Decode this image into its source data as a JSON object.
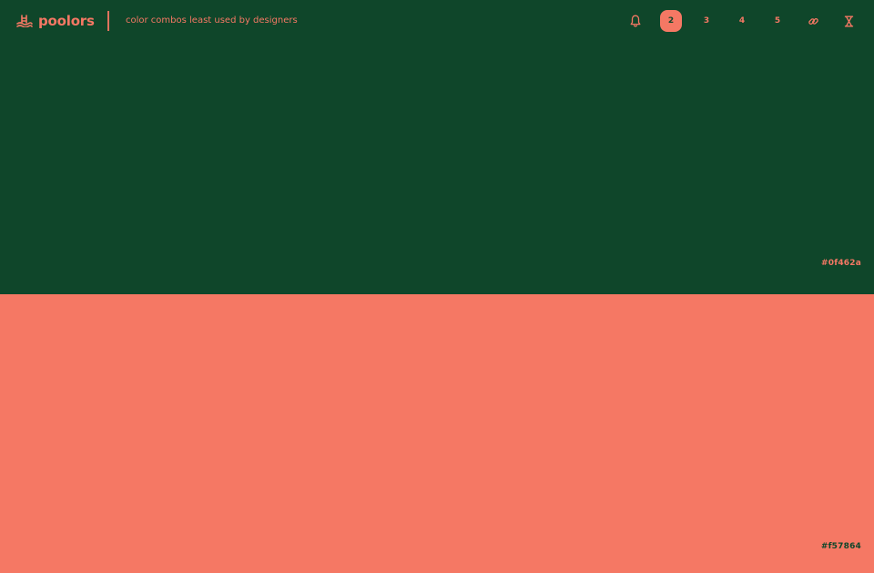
{
  "colors": {
    "primary": "#0f462a",
    "secondary": "#f57864"
  },
  "header": {
    "brand_name": "poolors",
    "brand_icon": "pool-icon",
    "tagline": "color combos least used by designers",
    "controls": [
      {
        "type": "icon",
        "icon": "bell-icon"
      },
      {
        "type": "count",
        "label": "2",
        "active": true
      },
      {
        "type": "count",
        "label": "3",
        "active": false
      },
      {
        "type": "count",
        "label": "4",
        "active": false
      },
      {
        "type": "count",
        "label": "5",
        "active": false
      },
      {
        "type": "icon",
        "icon": "link-icon"
      },
      {
        "type": "icon",
        "icon": "hourglass-icon"
      }
    ]
  },
  "palette": [
    {
      "hex": "#0f462a"
    },
    {
      "hex": "#f57864"
    }
  ]
}
